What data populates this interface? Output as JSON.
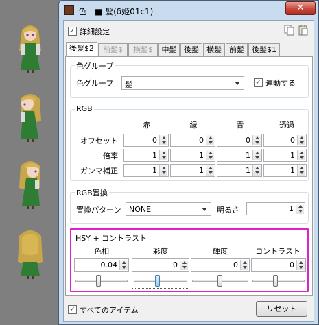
{
  "window": {
    "title": "色 - ■ 髪(δ姫01c1)",
    "close": "✕"
  },
  "top": {
    "detail_label": "詳細設定",
    "detail_checked": true
  },
  "tabs": [
    {
      "label": "後髪$2",
      "state": "active"
    },
    {
      "label": "前髪$",
      "state": "disabled"
    },
    {
      "label": "横髪$",
      "state": "disabled"
    },
    {
      "label": "中髪",
      "state": "normal"
    },
    {
      "label": "後髪",
      "state": "normal"
    },
    {
      "label": "横髪",
      "state": "normal"
    },
    {
      "label": "前髪",
      "state": "normal"
    },
    {
      "label": "後髪$1",
      "state": "normal"
    }
  ],
  "color_group": {
    "title": "色グループ",
    "label": "色グループ",
    "value": "髪",
    "link_label": "連動する",
    "link_checked": true
  },
  "rgb": {
    "title": "RGB",
    "headers": [
      "赤",
      "緑",
      "青",
      "透過"
    ],
    "rows": [
      {
        "label": "オフセット",
        "values": [
          "0",
          "0",
          "0",
          "0"
        ]
      },
      {
        "label": "倍率",
        "values": [
          "1",
          "1",
          "1",
          "1"
        ]
      },
      {
        "label": "ガンマ補正",
        "values": [
          "1",
          "1",
          "1",
          "1"
        ]
      }
    ]
  },
  "rgb_replace": {
    "title": "RGB置換",
    "pattern_label": "置換パターン",
    "pattern_value": "NONE",
    "brightness_label": "明るさ",
    "brightness_value": "1"
  },
  "hsy": {
    "title": "HSY + コントラスト",
    "highlight_color": "#e020c8",
    "headers": [
      "色相",
      "彩度",
      "輝度",
      "コントラスト"
    ],
    "values": [
      "0.04",
      "0",
      "0",
      "0"
    ],
    "slider_levels": [
      0.45,
      0.45,
      0.5,
      0.45
    ]
  },
  "footer": {
    "all_items_label": "すべてのアイテム",
    "all_items_checked": true,
    "reset_label": "リセット"
  },
  "icons": {
    "copy": "copy-icon",
    "paste": "paste-icon"
  }
}
